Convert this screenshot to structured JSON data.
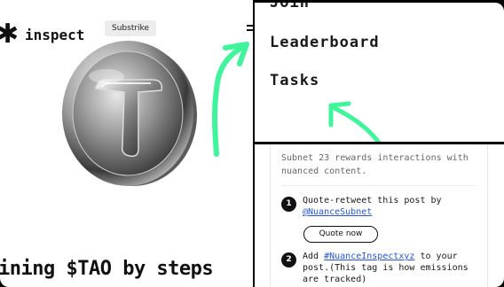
{
  "brand": {
    "logo_glyph": "✱",
    "name": "inspect",
    "badge": "Substrike"
  },
  "headline": "ining $TAO by steps",
  "nav": {
    "items": [
      {
        "key": "join",
        "label": "Join"
      },
      {
        "key": "leaderboard",
        "label": "Leaderboard"
      },
      {
        "key": "tasks",
        "label": "Tasks"
      }
    ]
  },
  "task": {
    "description": "Subnet 23 rewards interactions with nuanced content.",
    "steps": [
      {
        "number": "1",
        "text": "Quote-retweet this post by",
        "link": "@NuanceSubnet",
        "button": "Quote now"
      },
      {
        "number": "2",
        "text_before": "Add",
        "link": "#NuanceInspectxyz",
        "text_after": "to your post.(This tag is how emissions are tracked)"
      }
    ]
  },
  "colors": {
    "arrow": "#3ef59c",
    "link": "#2454d8",
    "background": "#000000"
  },
  "icons": {
    "coin": "tao-coin-icon",
    "arrow": "green-arrow-icon"
  }
}
